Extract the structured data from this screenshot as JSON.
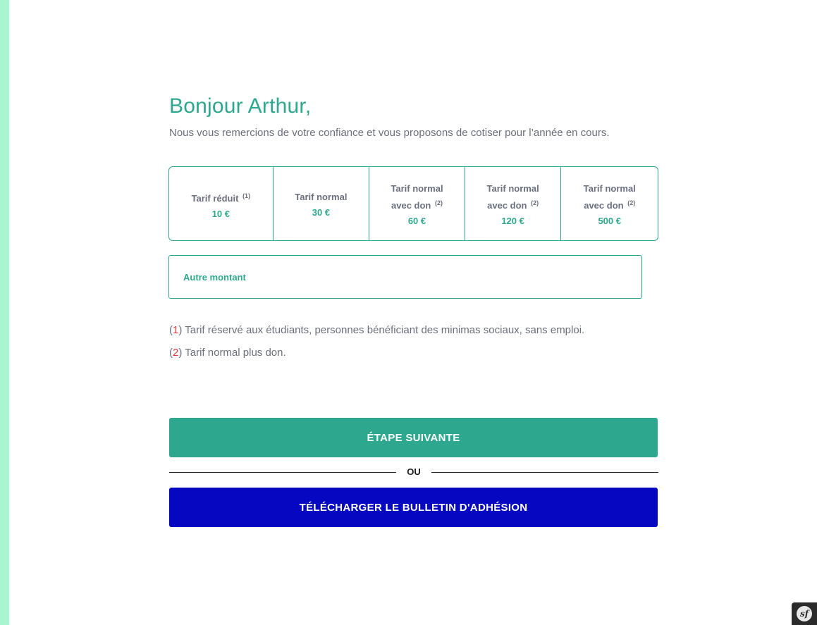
{
  "greeting": "Bonjour Arthur,",
  "intro": "Nous vous remercions de votre confiance et vous proposons de cotiser pour l’année en cours.",
  "tarifs": [
    {
      "line1": "Tarif réduit",
      "line2": "",
      "note": "(1)",
      "price": "10 €"
    },
    {
      "line1": "Tarif normal",
      "line2": "",
      "note": "",
      "price": "30 €"
    },
    {
      "line1": "Tarif normal",
      "line2": "avec don",
      "note": "(2)",
      "price": "60 €"
    },
    {
      "line1": "Tarif normal",
      "line2": "avec don",
      "note": "(2)",
      "price": "120 €"
    },
    {
      "line1": "Tarif normal",
      "line2": "avec don",
      "note": "(2)",
      "price": "500 €"
    }
  ],
  "autre_montant": {
    "placeholder": "Autre montant",
    "value": ""
  },
  "notes": [
    {
      "num": "1",
      "text": "Tarif réservé aux étudiants, personnes bénéficiant des minimas sociaux, sans emploi."
    },
    {
      "num": "2",
      "text": "Tarif normal plus don."
    }
  ],
  "buttons": {
    "next": "ÉTAPE SUIVANTE",
    "separator": "OU",
    "download": "TÉLÉCHARGER LE BULLETIN D'ADHÉSION"
  },
  "colors": {
    "accent": "#2da78d",
    "strip": "#a8f5d2",
    "download_button": "#0508c0",
    "note_number": "#e03b3b",
    "text": "#6b6e7e"
  },
  "debug_toolbar": {
    "icon": "symfony-icon",
    "glyph": "sf"
  }
}
